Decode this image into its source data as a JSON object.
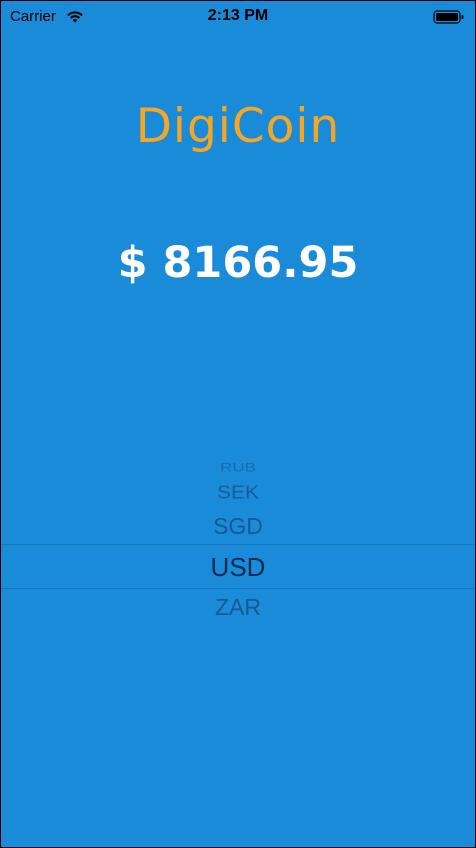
{
  "status_bar": {
    "carrier": "Carrier",
    "time": "2:13 PM",
    "wifi_icon": "wifi-icon",
    "battery_icon": "battery-full-icon"
  },
  "app": {
    "title": "DigiCoin",
    "title_color": "#f5a623",
    "background_color": "#1a8bd9"
  },
  "price": {
    "label": "$ 8166.95"
  },
  "currency_picker": {
    "selected": "USD",
    "visible_options": [
      "RUB",
      "SEK",
      "SGD",
      "USD",
      "ZAR"
    ]
  }
}
